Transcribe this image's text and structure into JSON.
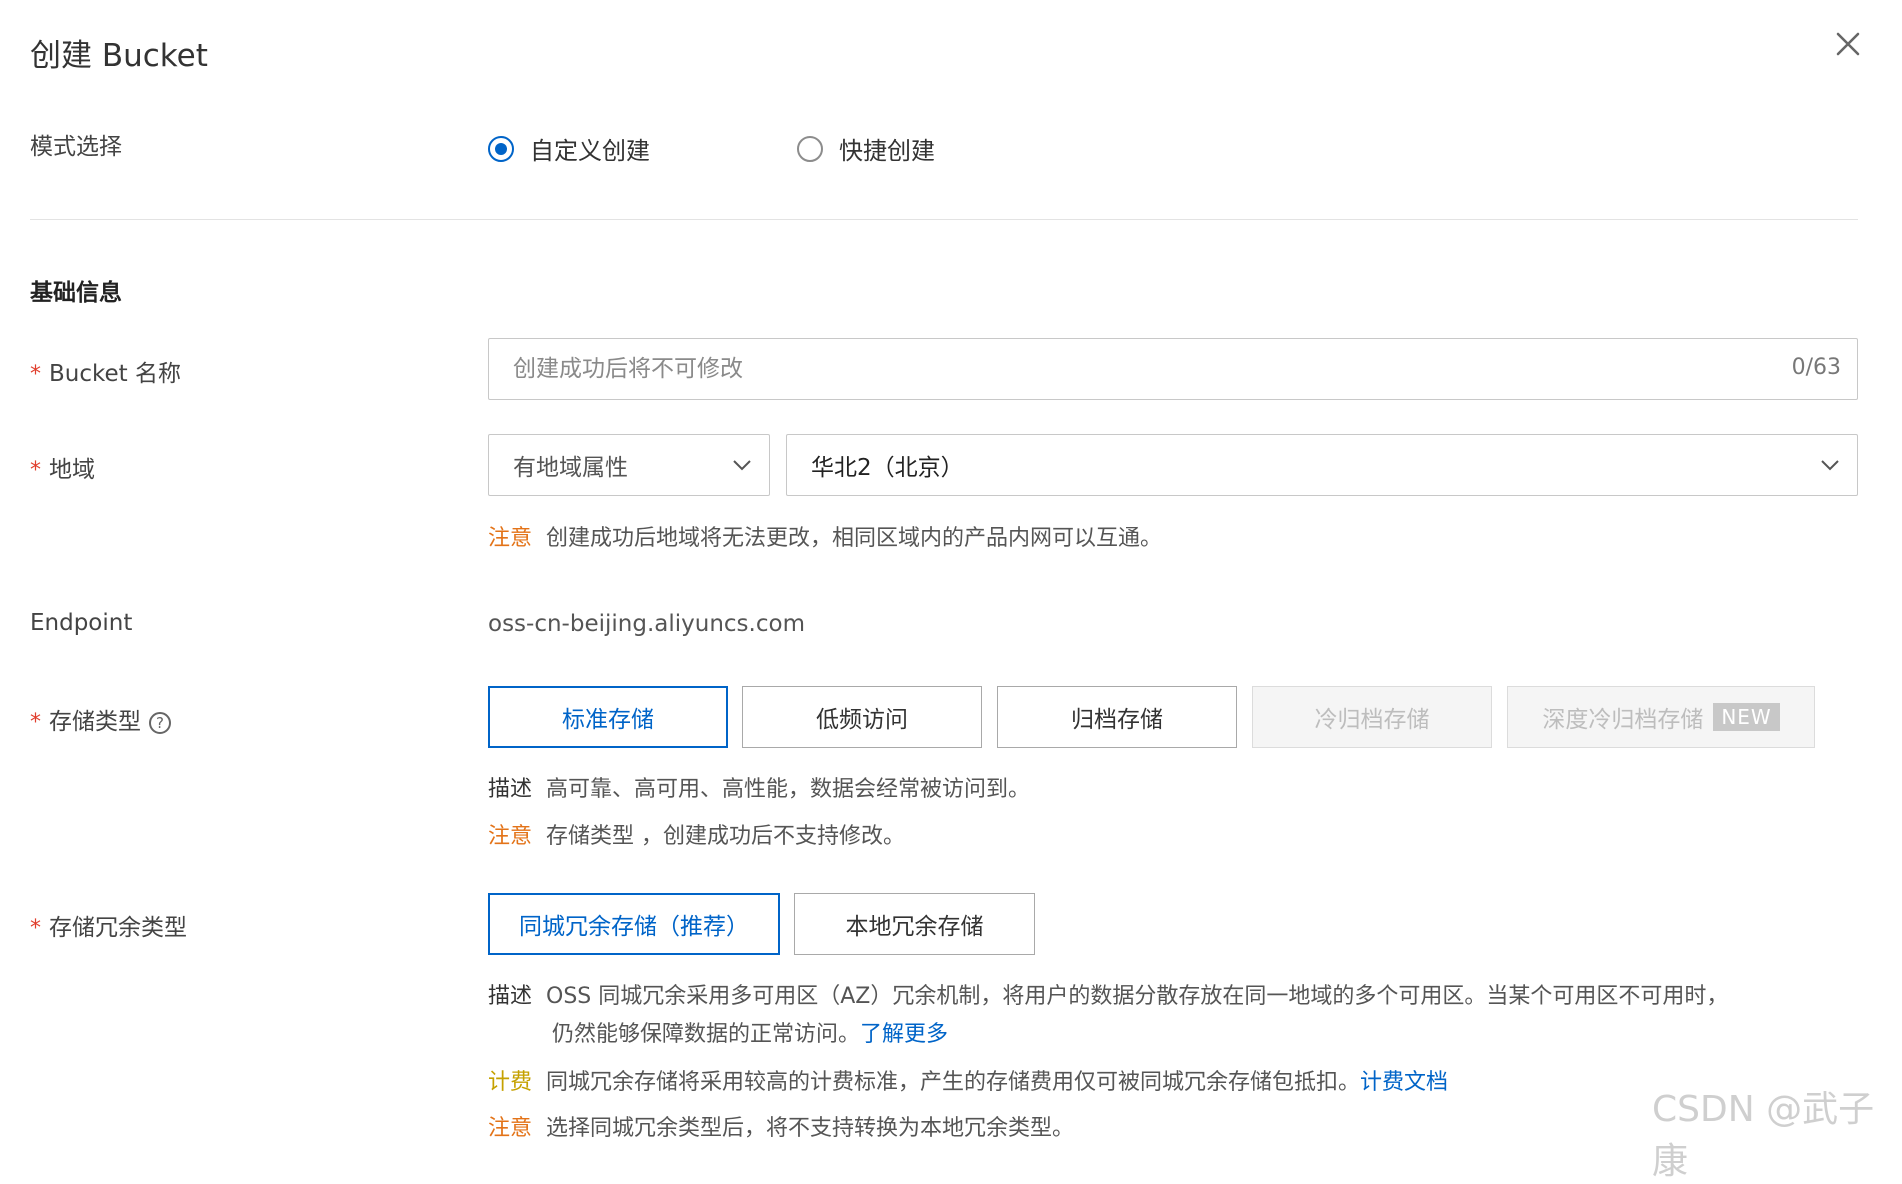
{
  "dialog": {
    "title": "创建 Bucket",
    "close_icon": "close-icon"
  },
  "mode": {
    "label": "模式选择",
    "options": [
      {
        "label": "自定义创建",
        "selected": true
      },
      {
        "label": "快捷创建",
        "selected": false
      }
    ]
  },
  "basic_info": {
    "title": "基础信息"
  },
  "bucket_name": {
    "required_mark": "*",
    "label": "Bucket 名称",
    "placeholder": "创建成功后将不可修改",
    "value": "",
    "counter": "0/63"
  },
  "region": {
    "required_mark": "*",
    "label": "地域",
    "type_select": "有地域属性",
    "region_select": "华北2（北京）",
    "note_tag": "注意",
    "note_text": "创建成功后地域将无法更改，相同区域内的产品内网可以互通。"
  },
  "endpoint": {
    "label": "Endpoint",
    "value": "oss-cn-beijing.aliyuncs.com"
  },
  "storage_type": {
    "required_mark": "*",
    "label": "存储类型",
    "help_icon": "?",
    "options": [
      {
        "label": "标准存储",
        "state": "selected"
      },
      {
        "label": "低频访问",
        "state": "normal"
      },
      {
        "label": "归档存储",
        "state": "normal"
      },
      {
        "label": "冷归档存储",
        "state": "disabled"
      },
      {
        "label": "深度冷归档存储",
        "state": "disabled",
        "badge": "NEW"
      }
    ],
    "desc_tag": "描述",
    "desc_text": "高可靠、高可用、高性能，数据会经常被访问到。",
    "note_tag": "注意",
    "note_text": "存储类型 ，创建成功后不支持修改。"
  },
  "redundancy": {
    "required_mark": "*",
    "label": "存储冗余类型",
    "options": [
      {
        "label": "同城冗余存储（推荐）",
        "state": "selected"
      },
      {
        "label": "本地冗余存储",
        "state": "normal"
      }
    ],
    "desc_tag": "描述",
    "desc_line1": "OSS 同城冗余采用多可用区（AZ）冗余机制，将用户的数据分散存放在同一地域的多个可用区。当某个可用区不可用时，",
    "desc_line2": "仍然能够保障数据的正常访问。",
    "desc_link": "了解更多",
    "billing_tag": "计费",
    "billing_text": "同城冗余存储将采用较高的计费标准，产生的存储费用仅可被同城冗余存储包抵扣。",
    "billing_link": "计费文档",
    "note_tag": "注意",
    "note_text": "选择同城冗余类型后，将不支持转换为本地冗余类型。"
  },
  "watermark": "CSDN @武子康",
  "colors": {
    "primary": "#0064c8",
    "warning": "#e37318",
    "billing": "#c5a100",
    "required": "#e03e2d"
  }
}
